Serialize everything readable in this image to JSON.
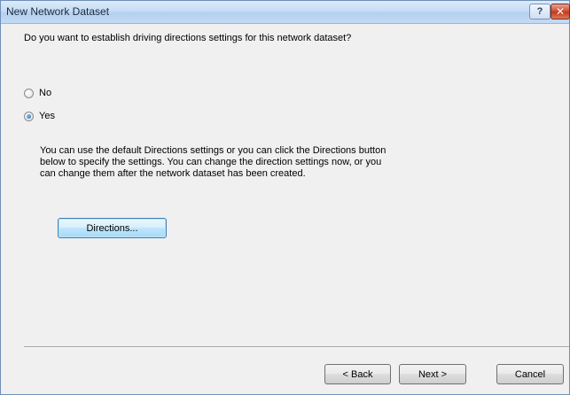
{
  "window": {
    "title": "New Network Dataset",
    "help_label": "?",
    "close_label": "✕"
  },
  "content": {
    "question": "Do you want to establish driving directions settings for this network dataset?",
    "options": [
      {
        "label": "No",
        "selected": false
      },
      {
        "label": "Yes",
        "selected": true
      }
    ],
    "description_lines": [
      "You can use the default Directions settings or you can click the Directions button",
      "below to specify the settings. You can change the direction settings now, or you",
      "can change them after the network dataset has been created."
    ],
    "directions_button": "Directions..."
  },
  "footer": {
    "back": "< Back",
    "next": "Next >",
    "cancel": "Cancel"
  }
}
